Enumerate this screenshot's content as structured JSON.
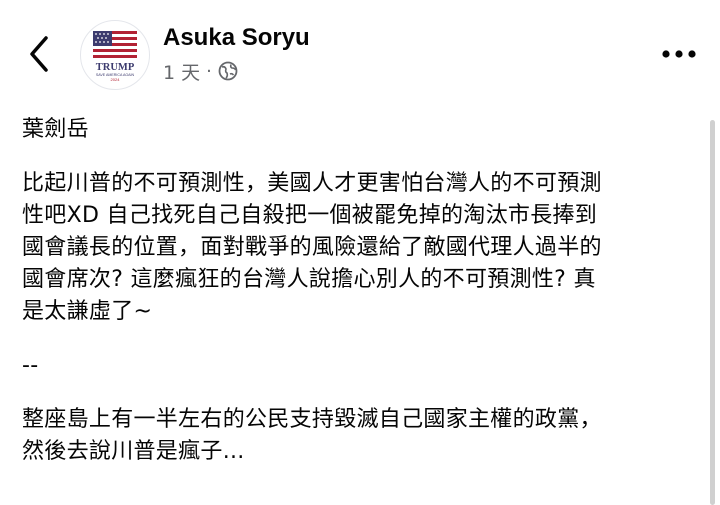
{
  "header": {
    "author_name": "Asuka Soryu",
    "timestamp": "1 天",
    "separator": "·",
    "privacy_icon": "globe-icon",
    "back_icon": "chevron-left-icon",
    "more_icon": "more-horizontal-icon",
    "avatar": {
      "line1": "TRUMP",
      "line2": "SAVE AMERICA AGAIN",
      "line3": "2024"
    }
  },
  "post": {
    "lines": [
      "葉劍岳",
      "",
      "比起川普的不可預測性，美國人才更害怕台灣人的不可預測",
      "性吧XD 自己找死自己自殺把一個被罷免掉的淘汰市長捧到",
      "國會議長的位置，面對戰爭的風險還給了敵國代理人過半的",
      "國會席次? 這麼瘋狂的台灣人說擔心別人的不可預測性? 真",
      "是太謙虛了~",
      "",
      "--",
      "",
      "整座島上有一半左右的公民支持毀滅自己國家主權的政黨，",
      "然後去說川普是瘋子..."
    ]
  },
  "colors": {
    "text": "#050505",
    "secondary": "#65676b",
    "flag_red": "#b22234",
    "flag_blue": "#3c3b6e"
  }
}
